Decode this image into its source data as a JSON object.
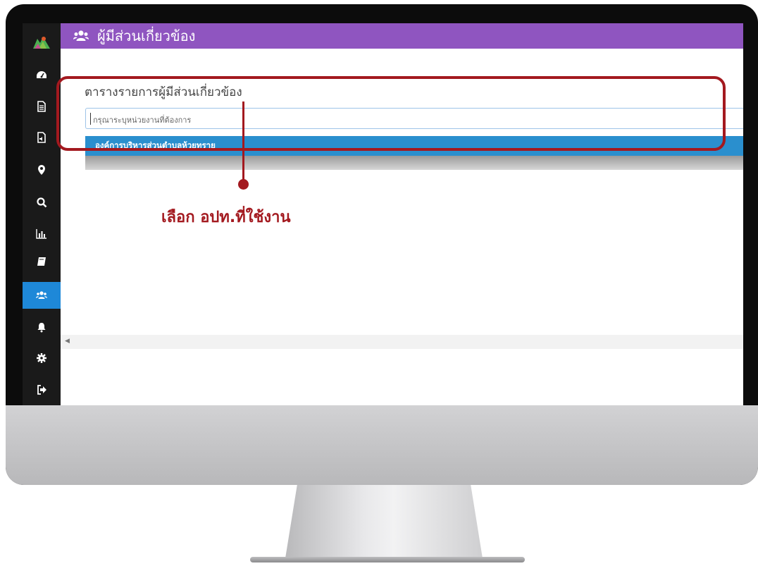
{
  "header": {
    "title": "ผู้มีส่วนเกี่ยวข้อง",
    "icon": "users-icon",
    "background": "#8f55c0"
  },
  "sidebar": {
    "items": [
      {
        "icon": "dashboard-icon"
      },
      {
        "icon": "document-icon"
      },
      {
        "icon": "audio-file-icon"
      },
      {
        "icon": "map-marker-icon"
      },
      {
        "icon": "search-icon"
      },
      {
        "icon": "bar-chart-icon"
      },
      {
        "icon": "book-icon"
      },
      {
        "icon": "users-icon",
        "active": true
      },
      {
        "icon": "bell-icon"
      },
      {
        "icon": "gear-icon"
      },
      {
        "icon": "sign-out-icon"
      }
    ],
    "active_color": "#1e88d8"
  },
  "main": {
    "section_title": "ตารางรายการผู้มีส่วนเกี่ยวข้อง",
    "search_placeholder": "กรุณาระบุหน่วยงานที่ต้องการ",
    "dropdown_option": "องค์การบริหารส่วนตำบลห้วยทราย"
  },
  "annotation": {
    "callout": "เลือก อปท.ที่ใช้งาน",
    "color": "#a3191f"
  }
}
